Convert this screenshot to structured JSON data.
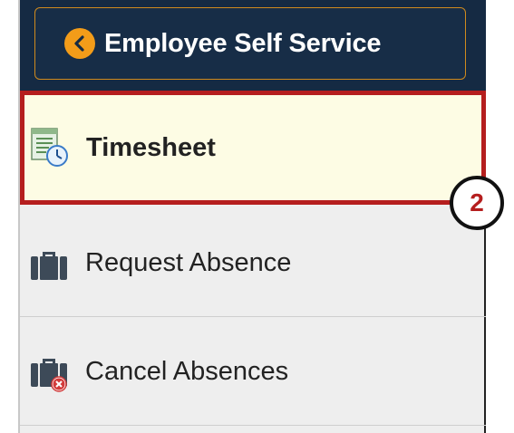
{
  "header": {
    "back_label": "Employee Self Service",
    "back_icon": "chevron-left-circle-icon"
  },
  "menu": {
    "items": [
      {
        "label": "Timesheet",
        "icon": "timesheet-icon",
        "selected": true
      },
      {
        "label": "Request Absence",
        "icon": "briefcase-icon",
        "selected": false
      },
      {
        "label": "Cancel Absences",
        "icon": "briefcase-cancel-icon",
        "selected": false
      }
    ]
  },
  "callout": {
    "number": "2"
  },
  "colors": {
    "header_bg": "#152a43",
    "back_border": "#d08a1e",
    "back_icon_bg": "#f39c19",
    "selected_bg": "#fdfce4",
    "highlight_red": "#b51e1e",
    "panel_bg": "#eeeeee"
  }
}
